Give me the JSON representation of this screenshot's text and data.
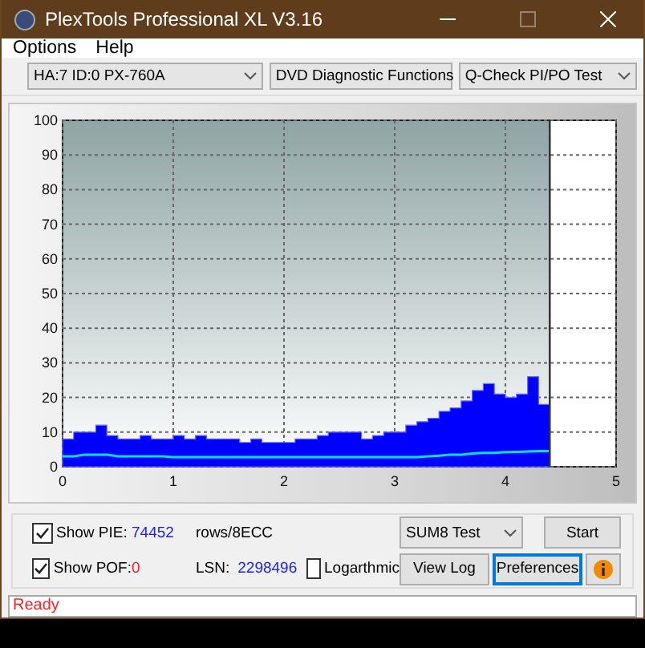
{
  "window": {
    "title": "PlexTools Professional XL V3.16"
  },
  "menu": [
    "Options",
    "Help"
  ],
  "toolbar": {
    "dropdowns": [
      "HA:7 ID:0  PX-760A",
      "DVD Diagnostic Functions",
      "Q-Check PI/PO Test"
    ]
  },
  "chart": {
    "chart_data": {
      "type": "area",
      "xlim": [
        0,
        5
      ],
      "ylim": [
        0,
        100
      ],
      "xticks": [
        0,
        1,
        2,
        3,
        4,
        5
      ],
      "yticks": [
        0,
        10,
        20,
        30,
        40,
        50,
        60,
        70,
        80,
        90,
        100
      ],
      "x": [
        0,
        0.1,
        0.2,
        0.3,
        0.4,
        0.5,
        0.6,
        0.7,
        0.8,
        0.9,
        1,
        1.1,
        1.2,
        1.3,
        1.4,
        1.5,
        1.6,
        1.7,
        1.8,
        1.9,
        2,
        2.1,
        2.2,
        2.3,
        2.4,
        2.5,
        2.6,
        2.7,
        2.8,
        2.9,
        3,
        3.1,
        3.2,
        3.3,
        3.4,
        3.5,
        3.6,
        3.7,
        3.8,
        3.9,
        4,
        4.1,
        4.2,
        4.3,
        4.4
      ],
      "series": [
        {
          "color": "#0000ff",
          "values": [
            8,
            10,
            10,
            12,
            9,
            8,
            8,
            9,
            8,
            8,
            9,
            8,
            9,
            8,
            8,
            8,
            7,
            8,
            7,
            7,
            7,
            8,
            8,
            9,
            10,
            10,
            10,
            8,
            9,
            10,
            10,
            12,
            13,
            14,
            16,
            17,
            19,
            22,
            24,
            21,
            20,
            21,
            26,
            18,
            14
          ]
        },
        {
          "color": "#00e5ff",
          "type": "line",
          "values": [
            3,
            3,
            3.5,
            3.5,
            3.5,
            3,
            3,
            3,
            3,
            3,
            2.8,
            2.8,
            2.8,
            2.8,
            2.8,
            2.8,
            2.8,
            2.8,
            2.8,
            2.8,
            2.8,
            2.8,
            2.8,
            2.8,
            2.8,
            2.8,
            2.8,
            2.8,
            2.8,
            2.8,
            2.8,
            2.8,
            2.8,
            3,
            3.2,
            3.5,
            3.5,
            3.8,
            4,
            4,
            4.2,
            4.3,
            4.4,
            4.5,
            4.5
          ]
        }
      ],
      "grid": true,
      "ref_lines": [
        {
          "axis": "x",
          "value": 4.4
        }
      ],
      "bands": [
        {
          "axis": "x",
          "from": 4.4,
          "to": 5,
          "color": "#ffffff"
        }
      ]
    }
  },
  "controls": {
    "show_pie": {
      "label": "Show PIE:",
      "checked": true,
      "value": "74452",
      "unit": "rows/8ECC"
    },
    "show_pof": {
      "label": "Show POF:",
      "checked": true,
      "value": "0"
    },
    "lsn": {
      "label": "LSN:",
      "value": "2298496"
    },
    "logarithmic": {
      "label": "Logarthmic",
      "checked": false
    },
    "test_dropdown": "SUM8 Test",
    "buttons": [
      {
        "label": "Start",
        "focused": false
      },
      {
        "label": "View Log",
        "focused": false
      },
      {
        "label": "Preferences",
        "focused": true
      }
    ]
  },
  "status_bar": "Ready"
}
